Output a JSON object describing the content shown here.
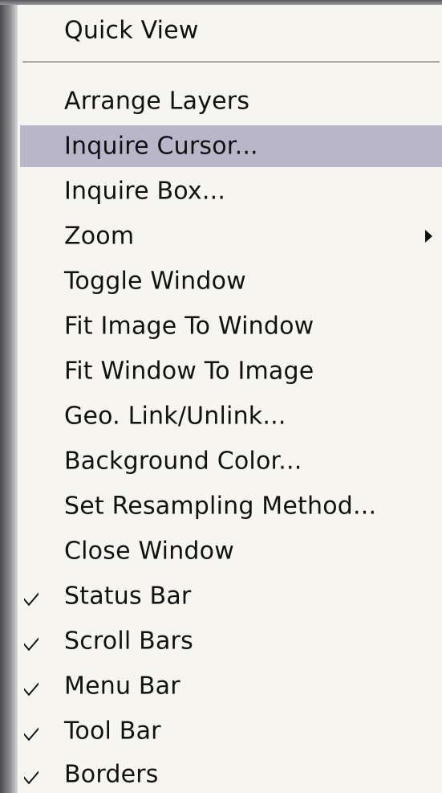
{
  "menu": {
    "top_items": [
      {
        "label": "Quick View",
        "checked": false,
        "submenu": false,
        "highlighted": false
      }
    ],
    "items": [
      {
        "label": "Arrange Layers",
        "checked": false,
        "submenu": false,
        "highlighted": false
      },
      {
        "label": "Inquire Cursor...",
        "checked": false,
        "submenu": false,
        "highlighted": true
      },
      {
        "label": "Inquire Box...",
        "checked": false,
        "submenu": false,
        "highlighted": false
      },
      {
        "label": "Zoom",
        "checked": false,
        "submenu": true,
        "highlighted": false
      },
      {
        "label": "Toggle Window",
        "checked": false,
        "submenu": false,
        "highlighted": false
      },
      {
        "label": "Fit Image To Window",
        "checked": false,
        "submenu": false,
        "highlighted": false
      },
      {
        "label": "Fit Window To Image",
        "checked": false,
        "submenu": false,
        "highlighted": false
      },
      {
        "label": "Geo. Link/Unlink...",
        "checked": false,
        "submenu": false,
        "highlighted": false
      },
      {
        "label": "Background Color...",
        "checked": false,
        "submenu": false,
        "highlighted": false
      },
      {
        "label": "Set Resampling Method...",
        "checked": false,
        "submenu": false,
        "highlighted": false
      },
      {
        "label": "Close Window",
        "checked": false,
        "submenu": false,
        "highlighted": false
      },
      {
        "label": "Status Bar",
        "checked": true,
        "submenu": false,
        "highlighted": false
      },
      {
        "label": "Scroll Bars",
        "checked": true,
        "submenu": false,
        "highlighted": false
      },
      {
        "label": "Menu Bar",
        "checked": true,
        "submenu": false,
        "highlighted": false
      },
      {
        "label": "Tool Bar",
        "checked": true,
        "submenu": false,
        "highlighted": false
      },
      {
        "label": "Borders",
        "checked": true,
        "submenu": false,
        "highlighted": false
      }
    ]
  },
  "icons": {
    "check": "checkmark-icon",
    "submenu": "submenu-arrow-icon"
  },
  "colors": {
    "menu_background": "#f6f5ef",
    "highlight": "#b8b6c8",
    "text": "#111111"
  }
}
